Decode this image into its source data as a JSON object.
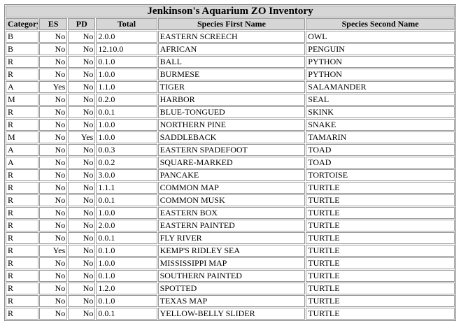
{
  "title": "Jenkinson's Aquarium ZO Inventory",
  "columns": [
    "Category",
    "ES",
    "PD",
    "Total",
    "Species First Name",
    "Species Second Name"
  ],
  "rows": [
    [
      "B",
      "No",
      "No",
      "2.0.0",
      "EASTERN SCREECH",
      "OWL"
    ],
    [
      "B",
      "No",
      "No",
      "12.10.0",
      "AFRICAN",
      "PENGUIN"
    ],
    [
      "R",
      "No",
      "No",
      "0.1.0",
      "BALL",
      "PYTHON"
    ],
    [
      "R",
      "No",
      "No",
      "1.0.0",
      "BURMESE",
      "PYTHON"
    ],
    [
      "A",
      "Yes",
      "No",
      "1.1.0",
      "TIGER",
      "SALAMANDER"
    ],
    [
      "M",
      "No",
      "No",
      "0.2.0",
      "HARBOR",
      "SEAL"
    ],
    [
      "R",
      "No",
      "No",
      "0.0.1",
      "BLUE-TONGUED",
      "SKINK"
    ],
    [
      "R",
      "No",
      "No",
      "1.0.0",
      "NORTHERN PINE",
      "SNAKE"
    ],
    [
      "M",
      "No",
      "Yes",
      "1.0.0",
      "SADDLEBACK",
      "TAMARIN"
    ],
    [
      "A",
      "No",
      "No",
      "0.0.3",
      "EASTERN SPADEFOOT",
      "TOAD"
    ],
    [
      "A",
      "No",
      "No",
      "0.0.2",
      "SQUARE-MARKED",
      "TOAD"
    ],
    [
      "R",
      "No",
      "No",
      "3.0.0",
      "PANCAKE",
      "TORTOISE"
    ],
    [
      "R",
      "No",
      "No",
      "1.1.1",
      "COMMON MAP",
      "TURTLE"
    ],
    [
      "R",
      "No",
      "No",
      "0.0.1",
      "COMMON MUSK",
      "TURTLE"
    ],
    [
      "R",
      "No",
      "No",
      "1.0.0",
      "EASTERN BOX",
      "TURTLE"
    ],
    [
      "R",
      "No",
      "No",
      "2.0.0",
      "EASTERN PAINTED",
      "TURTLE"
    ],
    [
      "R",
      "No",
      "No",
      "0.0.1",
      "FLY RIVER",
      "TURTLE"
    ],
    [
      "R",
      "Yes",
      "No",
      "0.1.0",
      "KEMP'S RIDLEY SEA",
      "TURTLE"
    ],
    [
      "R",
      "No",
      "No",
      "1.0.0",
      "MISSISSIPPI MAP",
      "TURTLE"
    ],
    [
      "R",
      "No",
      "No",
      "0.1.0",
      "SOUTHERN PAINTED",
      "TURTLE"
    ],
    [
      "R",
      "No",
      "No",
      "1.2.0",
      "SPOTTED",
      "TURTLE"
    ],
    [
      "R",
      "No",
      "No",
      "0.1.0",
      "TEXAS MAP",
      "TURTLE"
    ],
    [
      "R",
      "No",
      "No",
      "0.0.1",
      "YELLOW-BELLY SLIDER",
      "TURTLE"
    ]
  ]
}
